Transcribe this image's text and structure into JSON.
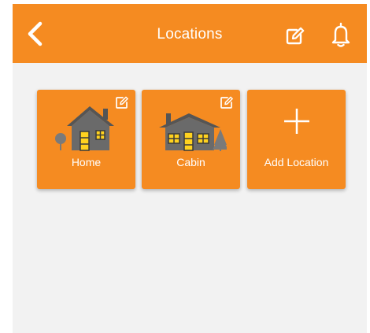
{
  "header": {
    "title": "Locations",
    "icons": {
      "back": "chevron-left-icon",
      "edit": "edit-icon",
      "notifications": "bell-icon"
    }
  },
  "locations": [
    {
      "label": "Home",
      "icon": "house-icon",
      "edit_icon": "edit-icon"
    },
    {
      "label": "Cabin",
      "icon": "cabin-icon",
      "edit_icon": "edit-icon"
    }
  ],
  "add_location": {
    "label": "Add Location",
    "icon": "plus-icon"
  },
  "colors": {
    "accent": "#f58b21",
    "background": "#f2f2f2",
    "text_on_accent": "#ffffff",
    "house_gray": "#6e6e6e",
    "window_yellow": "#ffd21f"
  }
}
